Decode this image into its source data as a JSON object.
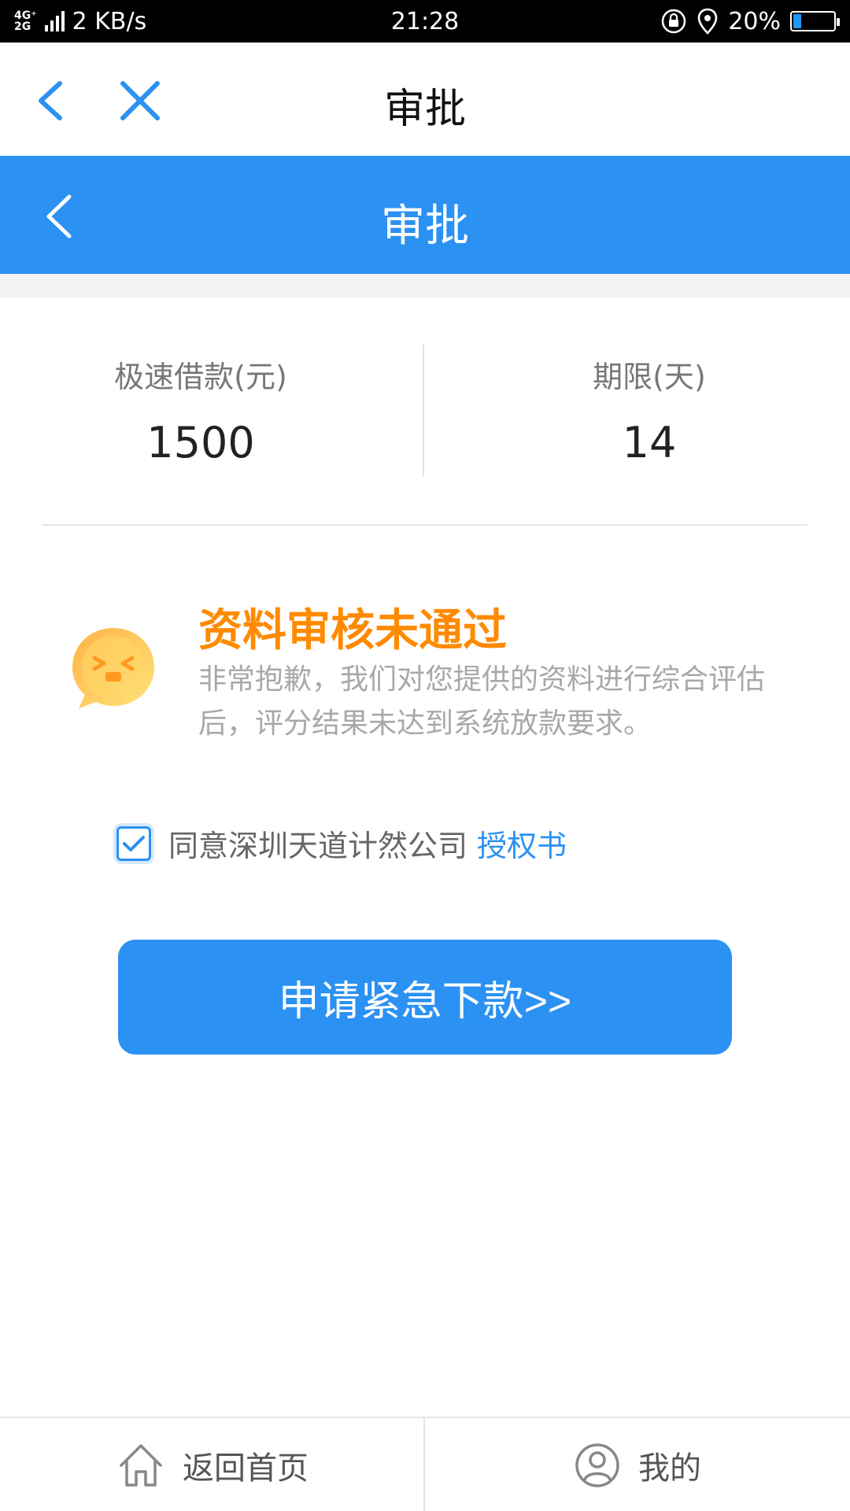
{
  "status_bar": {
    "network_top": "4G⁺",
    "network_bottom": "2G",
    "speed": "2 KB/s",
    "time": "21:28",
    "battery": "20%",
    "battery_level": 0.2
  },
  "webview": {
    "title": "审批"
  },
  "header": {
    "title": "审批"
  },
  "summary": {
    "loan_label": "极速借款(元)",
    "loan_value": "1500",
    "term_label": "期限(天)",
    "term_value": "14"
  },
  "result": {
    "title": "资料审核未通过",
    "description": "非常抱歉，我们对您提供的资料进行综合评估后，评分结果未达到系统放款要求。"
  },
  "agreement": {
    "checked": true,
    "text": "同意深圳天道计然公司",
    "link": "授权书"
  },
  "primary_button": {
    "label": "申请紧急下款>>"
  },
  "bottom_nav": {
    "home_label": "返回首页",
    "mine_label": "我的"
  },
  "colors": {
    "brand_blue": "#2b91f2",
    "warning_orange": "#ff8a00"
  }
}
